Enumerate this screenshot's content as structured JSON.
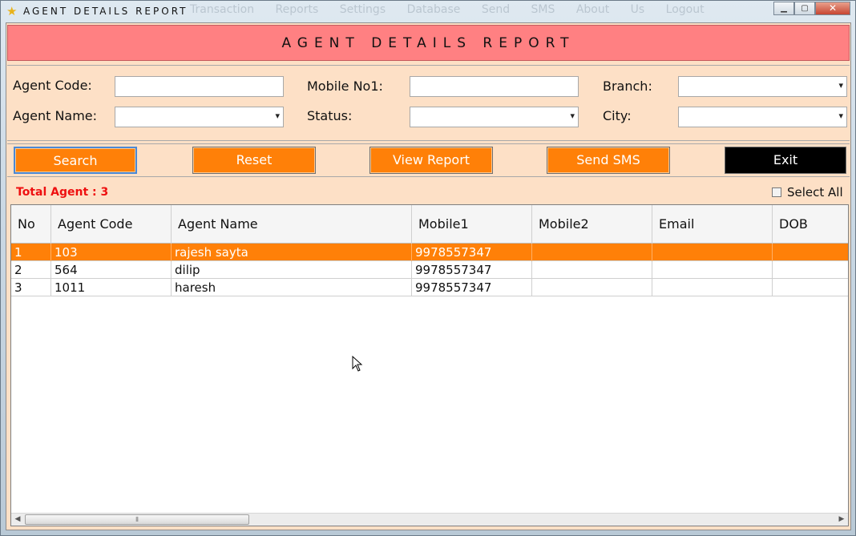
{
  "window": {
    "title": "AGENT DETAILS REPORT",
    "ghost_menu": "Transaction Reports Settings Database Send SMS About Us Logout"
  },
  "header": {
    "title": "AGENT DETAILS REPORT"
  },
  "filters": {
    "agent_code_label": "Agent Code:",
    "agent_name_label": "Agent Name:",
    "mobile_label": "Mobile No1:",
    "status_label": "Status:",
    "branch_label": "Branch:",
    "city_label": "City:"
  },
  "buttons": {
    "search": "Search",
    "reset": "Reset",
    "view_report": "View Report",
    "send_sms": "Send SMS",
    "exit": "Exit"
  },
  "summary": {
    "total_label": "Total Agent : 3",
    "select_all": "Select All"
  },
  "grid": {
    "columns": [
      "No",
      "Agent Code",
      "Agent Name",
      "Mobile1",
      "Mobile2",
      "Email",
      "DOB"
    ],
    "rows": [
      [
        "1",
        "103",
        "rajesh sayta",
        "9978557347",
        "",
        "",
        ""
      ],
      [
        "2",
        "564",
        "dilip",
        "9978557347",
        "",
        "",
        ""
      ],
      [
        "3",
        "1011",
        "haresh",
        "9978557347",
        "",
        "",
        ""
      ]
    ],
    "selected_row": 0
  },
  "colors": {
    "header_band": "#ff8082",
    "panel": "#fde0c6",
    "accent": "#ff8008",
    "total_text": "#ee1010"
  },
  "icons": {
    "app": "star-icon"
  }
}
